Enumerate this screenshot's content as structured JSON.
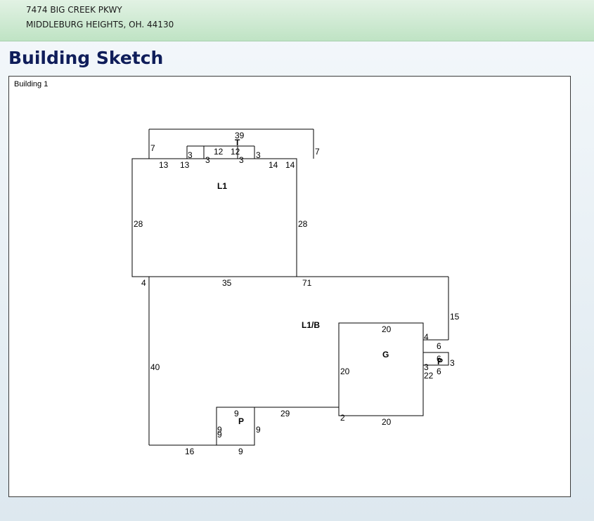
{
  "header": {
    "address_line1": "7474 BIG CREEK PKWY",
    "address_line2": "MIDDLEBURG HEIGHTS, OH. 44130"
  },
  "page_title": "Building Sketch",
  "sketch": {
    "building_label": "Building 1",
    "area_labels": {
      "upper": "L1",
      "main": "L1/B",
      "garage": "G",
      "porch_front": "P",
      "porch_side": "P",
      "top_bump": "T"
    },
    "dimensions": {
      "top_39": "39",
      "top_7_left": "7",
      "top_7_right": "7",
      "t_3_a": "3",
      "t_3_b": "3",
      "t_3_c": "3",
      "t_3_d": "3",
      "t_12_a": "12",
      "t_12_b": "12",
      "l1_13_a": "13",
      "l1_13_b": "13",
      "l1_14_a": "14",
      "l1_14_b": "14",
      "l1_28_left": "28",
      "l1_28_right": "28",
      "main_4": "4",
      "main_35": "35",
      "main_71": "71",
      "main_15": "15",
      "main_40": "40",
      "g_20_top": "20",
      "g_20_left": "20",
      "g_20_bottom": "20",
      "g_4": "4",
      "g_2": "2",
      "g_22": "22",
      "ps_6_a": "6",
      "ps_6_b": "6",
      "ps_6_c": "6",
      "ps_3_a": "3",
      "ps_3_b": "3",
      "main_29": "29",
      "main_16": "16",
      "pf_9_top": "9",
      "pf_9_right": "9",
      "pf_9_bottom": "9",
      "pf_9_left_a": "9",
      "pf_9_left_b": "9"
    }
  }
}
